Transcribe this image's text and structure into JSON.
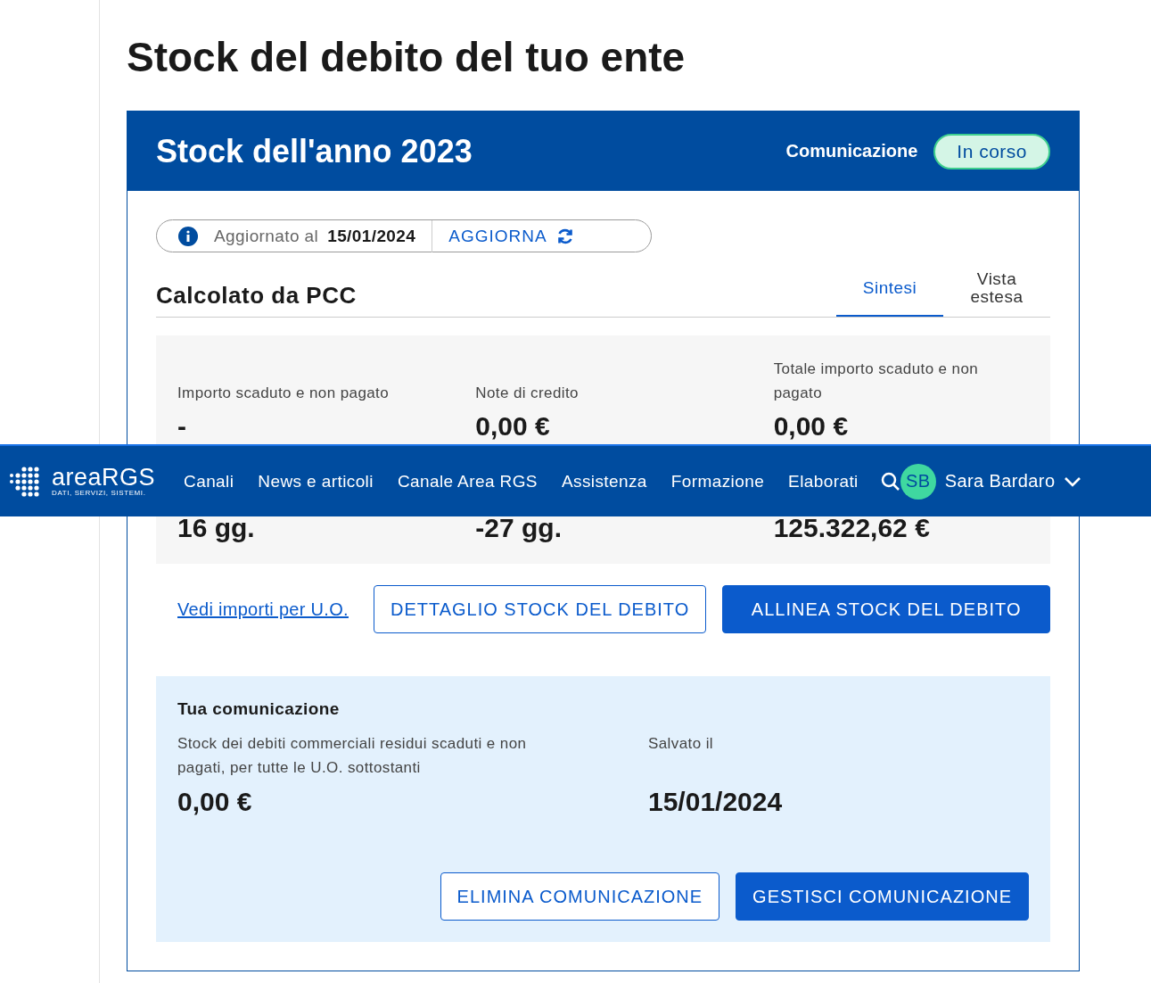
{
  "page": {
    "title": "Stock del debito del tuo ente"
  },
  "card": {
    "title": "Stock dell'anno 2023",
    "status_label": "Comunicazione",
    "status": "In corso"
  },
  "update_bar": {
    "label": "Aggiornato al",
    "date": "15/01/2024",
    "action": "AGGIORNA"
  },
  "section": {
    "title": "Calcolato da PCC",
    "tabs": [
      {
        "label": "Sintesi",
        "selected": true
      },
      {
        "label": "Vista estesa",
        "selected": false
      }
    ]
  },
  "metrics": [
    {
      "label": "Importo scaduto e non pagato",
      "value": "-"
    },
    {
      "label": "Note di credito",
      "value": "0,00 €"
    },
    {
      "label": "Totale importo scaduto e non pagato",
      "value": "0,00 €"
    },
    {
      "value": "16 gg."
    },
    {
      "value": "-27 gg."
    },
    {
      "value": "125.322,62 €"
    }
  ],
  "actions": {
    "link": "Vedi importi per U.O.",
    "buttons": [
      {
        "label": "DETTAGLIO STOCK DEL DEBITO",
        "kind": "outline"
      },
      {
        "label": "ALLINEA STOCK DEL DEBITO",
        "kind": "filled"
      }
    ]
  },
  "communication": {
    "title": "Tua comunicazione",
    "fields": [
      {
        "label": "Stock dei debiti commerciali residui scaduti e non pagati, per tutte le U.O. sottostanti",
        "value": "0,00 €"
      },
      {
        "label": "Salvato il",
        "value": "15/01/2024"
      }
    ],
    "buttons": [
      {
        "label": "ELIMINA COMUNICAZIONE",
        "kind": "outline"
      },
      {
        "label": "GESTISCI COMUNICAZIONE",
        "kind": "filled"
      }
    ]
  },
  "navbar": {
    "logo": "areaRGS",
    "tagline": "DATI, SERVIZI, SISTEMI.",
    "items": [
      "Canali",
      "News e articoli",
      "Canale Area RGS",
      "Assistenza",
      "Formazione",
      "Elaborati"
    ],
    "user": {
      "initials": "SB",
      "name": "Sara Bardaro"
    }
  }
}
